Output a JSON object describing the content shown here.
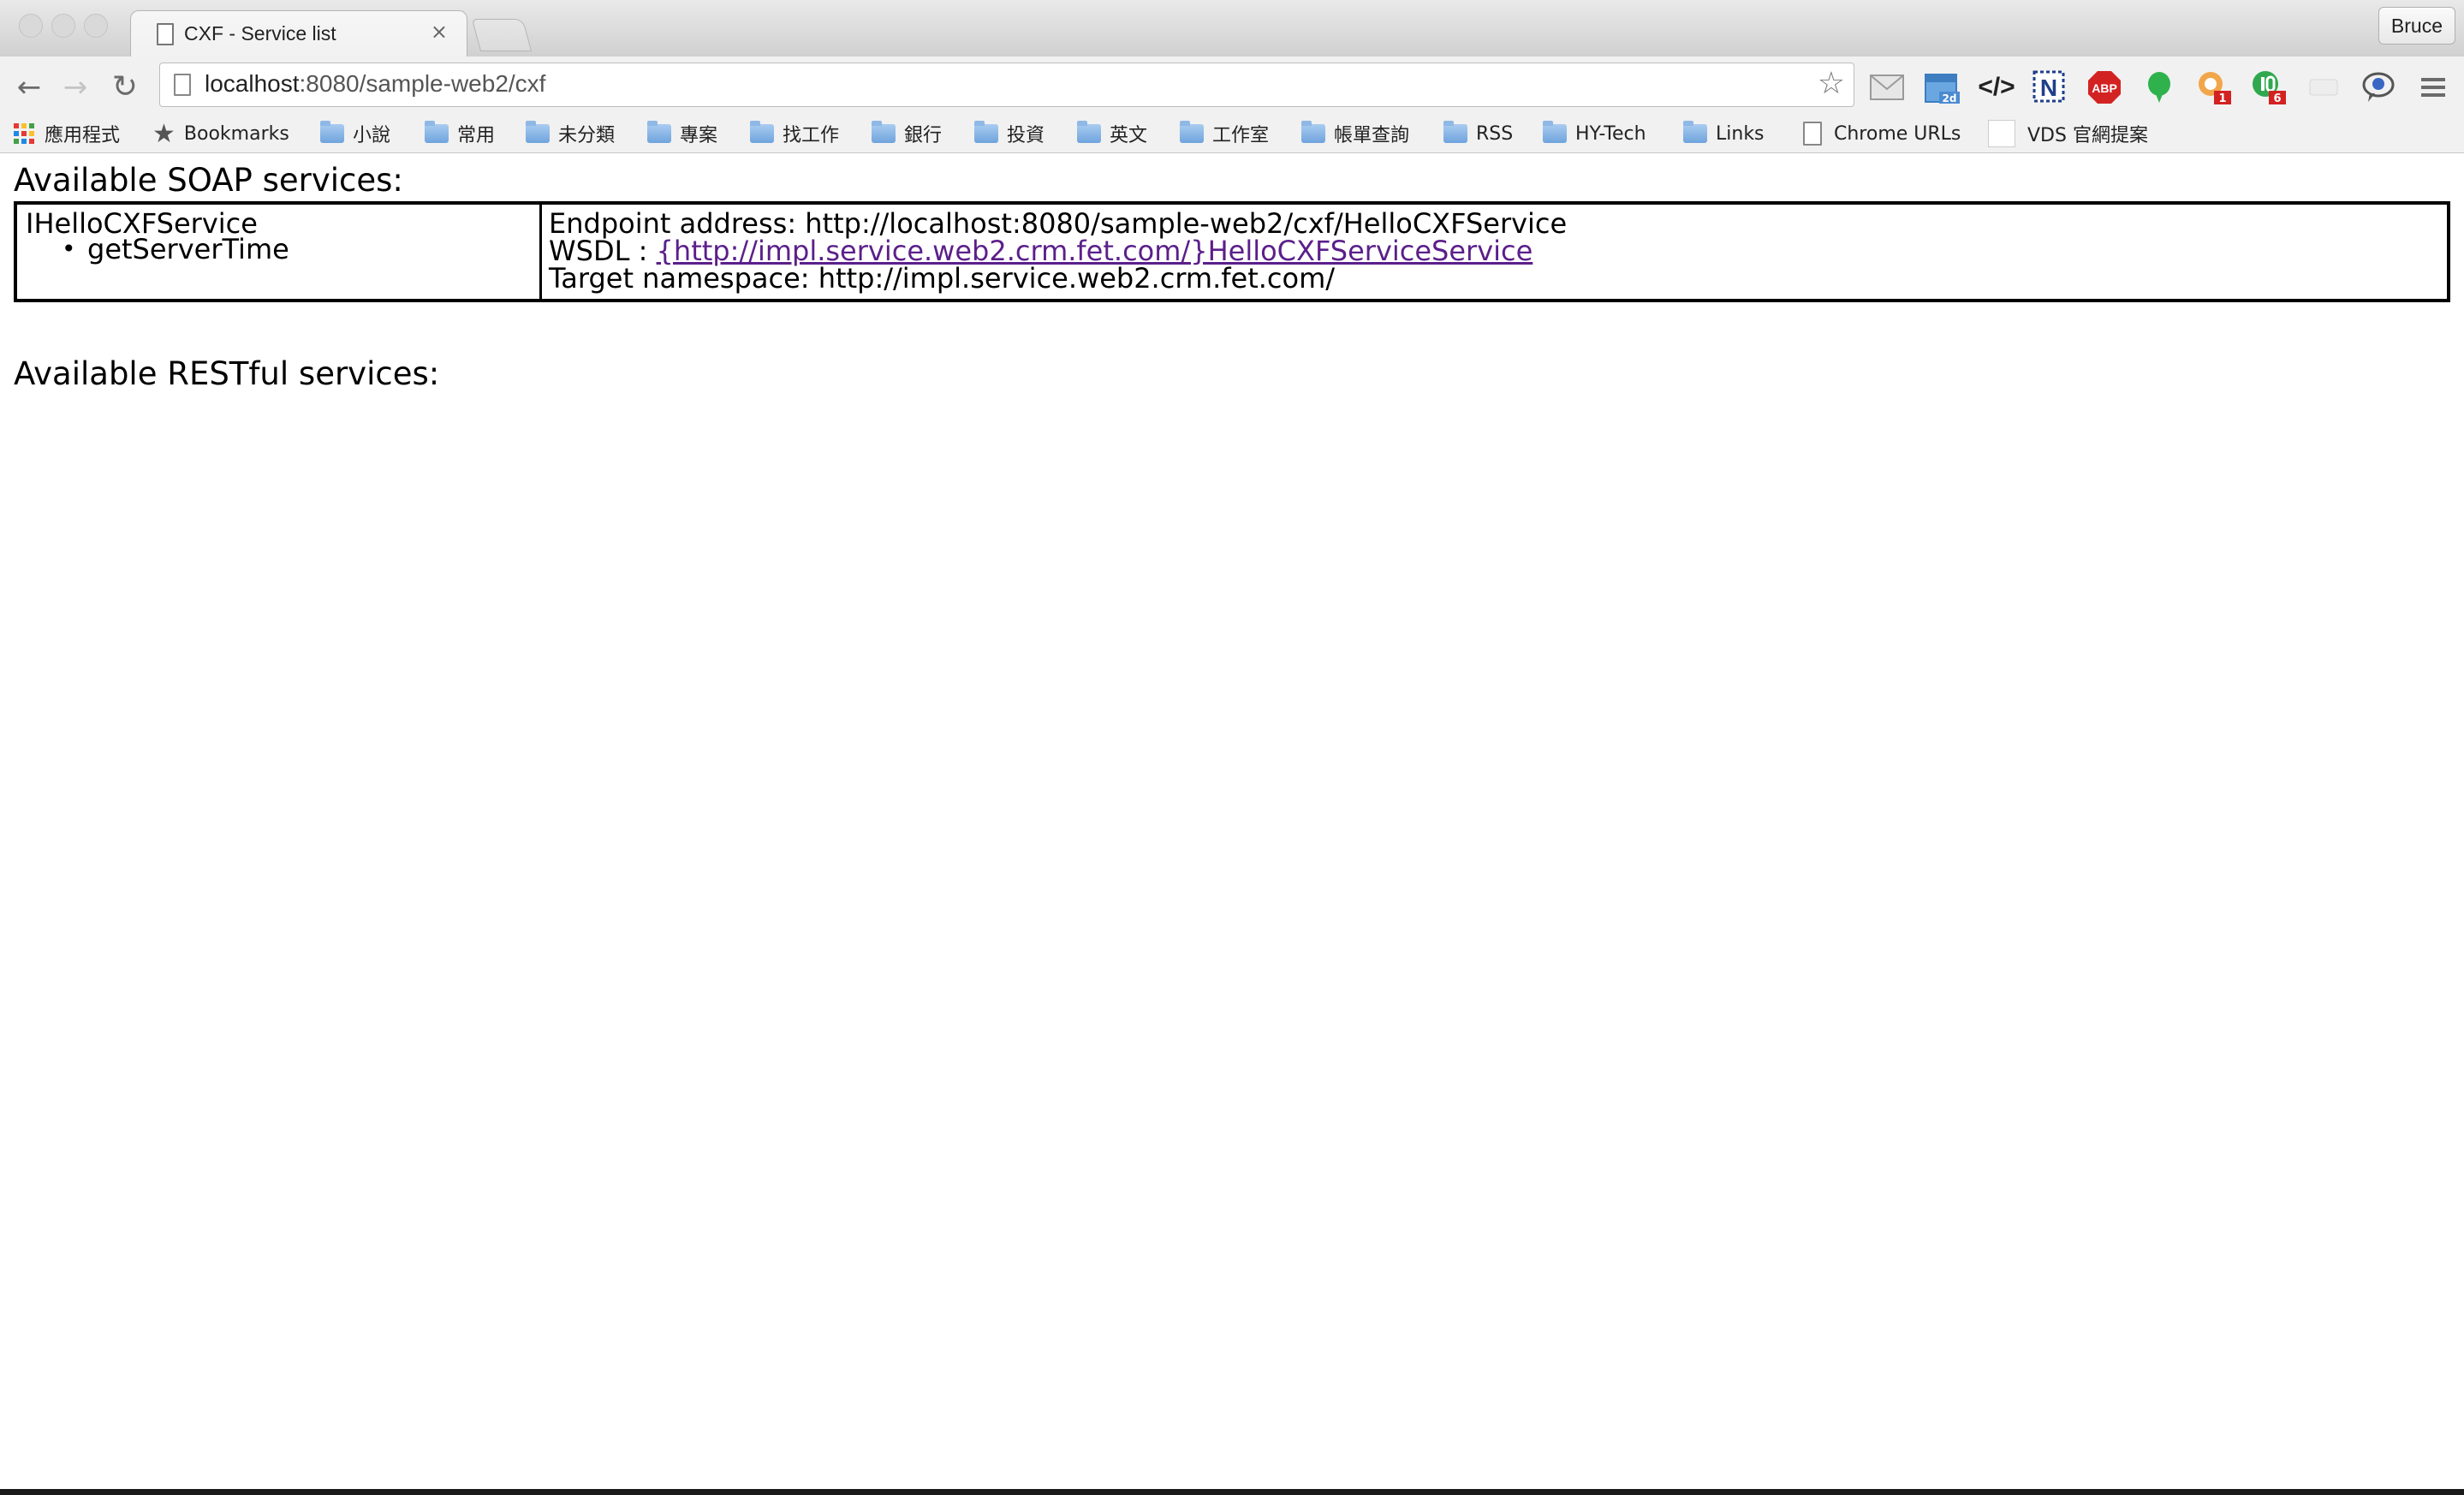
{
  "browser": {
    "tab_title": "CXF - Service list",
    "tab_close": "×",
    "profile_name": "Bruce",
    "url_host": "localhost",
    "url_path": ":8080/sample-web2/cxf",
    "extensions": [
      {
        "name": "gmail-icon",
        "badge": ""
      },
      {
        "name": "calendar-icon",
        "badge": "2d"
      },
      {
        "name": "code-view-icon",
        "badge": ""
      },
      {
        "name": "n-extension-icon",
        "badge": ""
      },
      {
        "name": "adblock-plus-icon",
        "badge": "ABP"
      },
      {
        "name": "evernote-icon",
        "badge": ""
      },
      {
        "name": "notification-icon",
        "badge": "1"
      },
      {
        "name": "id-extension-icon",
        "badge": "6"
      },
      {
        "name": "translate-icon",
        "badge": ""
      },
      {
        "name": "menu-icon",
        "badge": ""
      }
    ]
  },
  "bookmarks": [
    {
      "label": "應用程式",
      "type": "apps"
    },
    {
      "label": "Bookmarks",
      "type": "star"
    },
    {
      "label": "小說",
      "type": "folder"
    },
    {
      "label": "常用",
      "type": "folder"
    },
    {
      "label": "未分類",
      "type": "folder"
    },
    {
      "label": "專案",
      "type": "folder"
    },
    {
      "label": "找工作",
      "type": "folder"
    },
    {
      "label": "銀行",
      "type": "folder"
    },
    {
      "label": "投資",
      "type": "folder"
    },
    {
      "label": "英文",
      "type": "folder"
    },
    {
      "label": "工作室",
      "type": "folder"
    },
    {
      "label": "帳單查詢",
      "type": "folder"
    },
    {
      "label": "RSS",
      "type": "folder"
    },
    {
      "label": "HY-Tech",
      "type": "folder"
    },
    {
      "label": "Links",
      "type": "folder"
    },
    {
      "label": "Chrome URLs",
      "type": "page"
    },
    {
      "label": "VDS 官網提案",
      "type": "blank"
    }
  ],
  "page": {
    "soap_heading": "Available SOAP services:",
    "rest_heading": "Available RESTful services:",
    "service": {
      "name": "IHelloCXFService",
      "operations": [
        "getServerTime"
      ],
      "endpoint_label": "Endpoint address:",
      "endpoint_value": "http://localhost:8080/sample-web2/cxf/HelloCXFService",
      "wsdl_label": "WSDL :",
      "wsdl_link": "{http://impl.service.web2.crm.fet.com/}HelloCXFServiceService",
      "namespace_label": "Target namespace:",
      "namespace_value": "http://impl.service.web2.crm.fet.com/"
    }
  }
}
